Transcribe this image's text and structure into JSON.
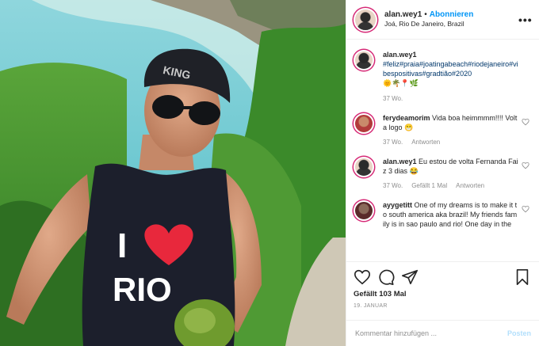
{
  "header": {
    "username": "alan.wey1",
    "separator": "•",
    "follow_label": "Abonnieren",
    "location": "Joá, Rio De Janeiro, Brazil",
    "more_label": "•••"
  },
  "photo": {
    "cap_text": "KING",
    "shirt_text_top": "I",
    "shirt_text_bottom": "RIO"
  },
  "comments": [
    {
      "username": "alan.wey1",
      "text": "#feliz#praia#joatingabeach#riodejaneiro#vibespositivas#gradtião#2020",
      "emoji": "🌞🌴📍🌿",
      "time": "37 Wo."
    },
    {
      "username": "ferydeamorim",
      "text": "Vida boa heimmmm!!!! Volta logo 😁",
      "time": "37 Wo.",
      "reply": "Antworten",
      "like_icon": "heart-outline"
    },
    {
      "username": "alan.wey1",
      "text": "Eu estou de volta Fernanda Faiz 3 dias 😂",
      "time": "37 Wo.",
      "likes": "Gefällt 1 Mal",
      "reply": "Antworten",
      "like_icon": "heart-outline"
    },
    {
      "username": "ayygetitt",
      "text": "One of my dreams is to make it to south america aka brazil! My friends family is in sao paulo and rio! One day in the",
      "like_icon": "heart-outline"
    }
  ],
  "actions": {
    "likes_text": "Gefällt 103 Mal",
    "date": "19. JANUAR",
    "icons": [
      "heart-outline",
      "comment-bubble",
      "share-paper-plane",
      "bookmark"
    ]
  },
  "add_comment": {
    "placeholder": "Kommentar hinzufügen ...",
    "post_label": "Posten"
  },
  "colors": {
    "accent_blue": "#0095f6",
    "hashtag": "#00376b",
    "muted": "#8e8e8e",
    "heart_red": "#e8283c"
  }
}
